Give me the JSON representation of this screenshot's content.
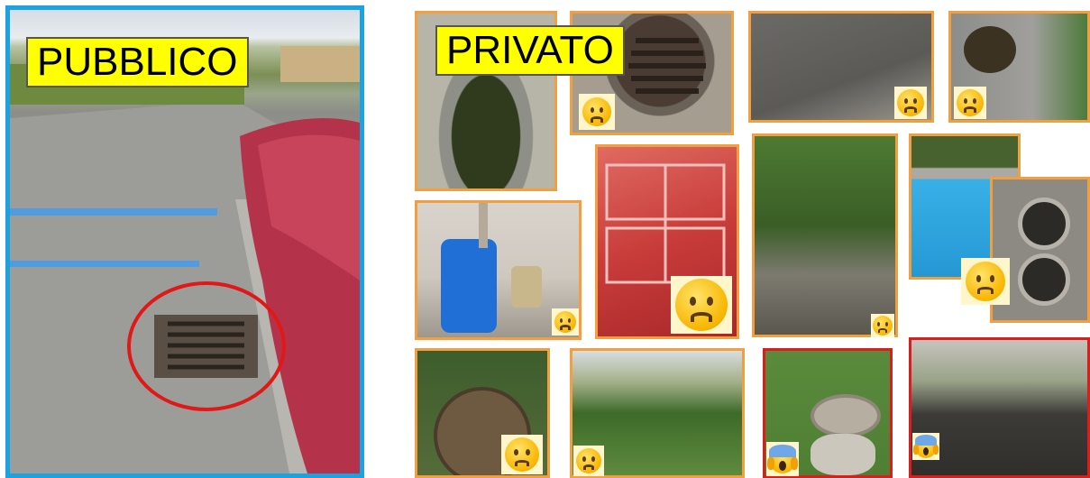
{
  "labels": {
    "public": "PUBBLICO",
    "private": "PRIVATO"
  },
  "colors": {
    "public_border": "#1aa3e0",
    "private_border": "#f0a040",
    "critical_border": "#d81e1e",
    "label_background": "#ffff00",
    "highlight_circle": "#e01818"
  },
  "icons": {
    "sad": "worried-face-icon",
    "scared": "screaming-face-icon"
  }
}
